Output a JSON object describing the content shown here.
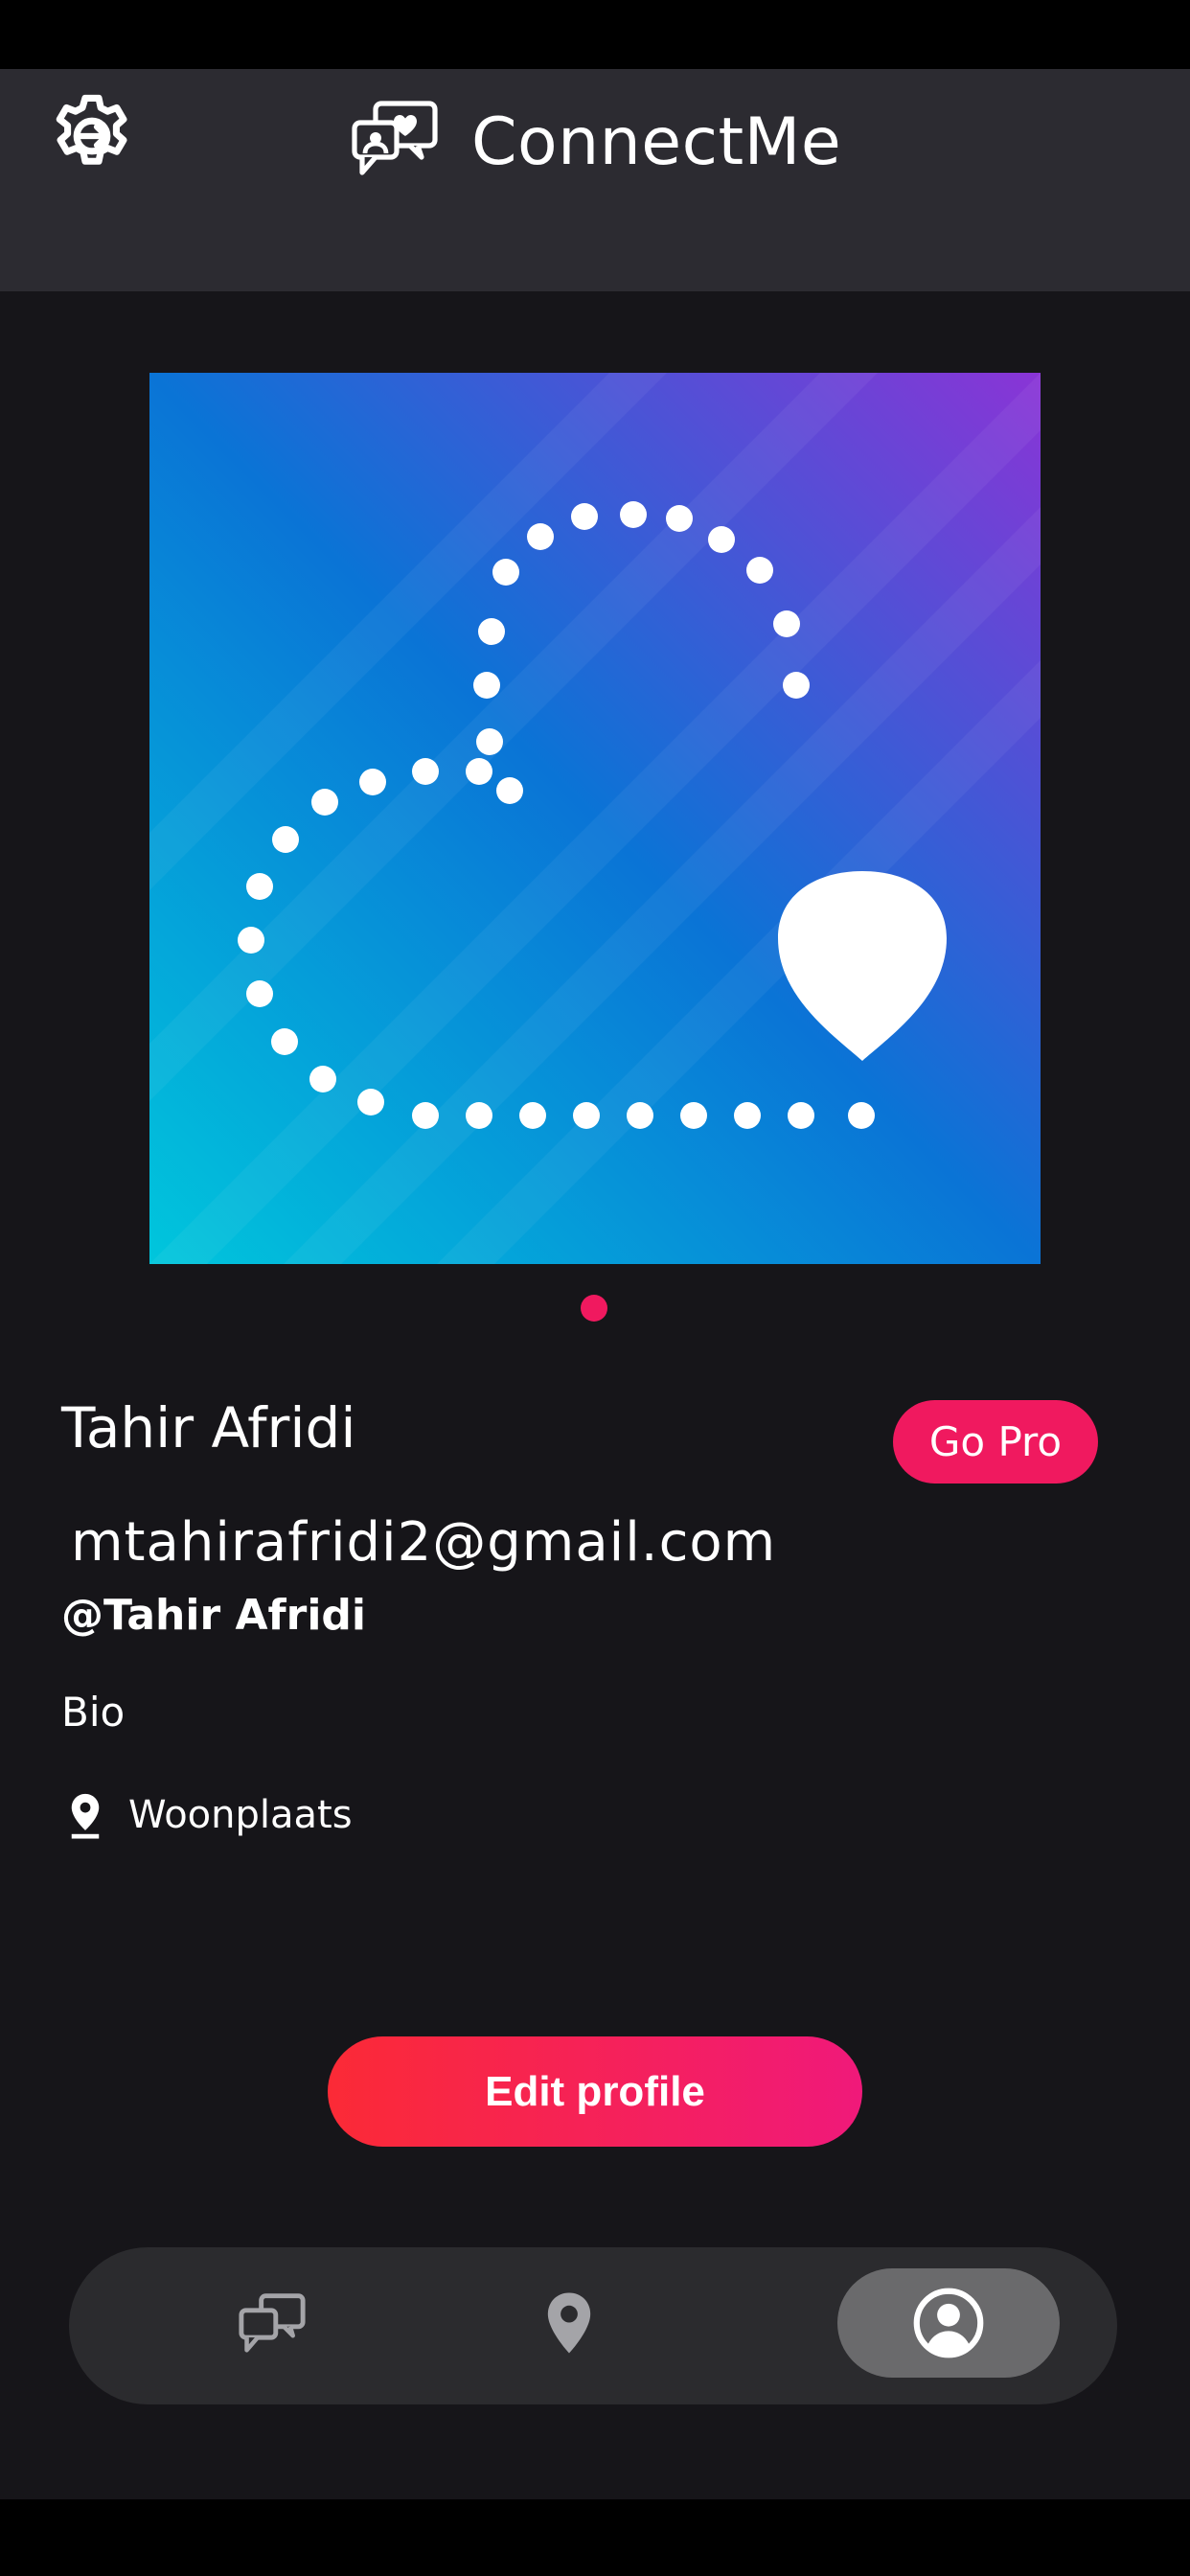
{
  "header": {
    "app_name": "ConnectMe",
    "settings_icon": "gear-icon",
    "logo_icon": "chat-bubbles-heart-icon"
  },
  "profile": {
    "photo_icon": "dotted-heart-location-pin-illustration",
    "photo_gradient": [
      "#00c6dc",
      "#0a74d6",
      "#8a34d6"
    ],
    "page_indicator_color": "#f0195f",
    "name": "Tahir Afridi",
    "go_pro_label": "Go Pro",
    "email": "mtahirafridi2@gmail.com",
    "handle": "@Tahir Afridi",
    "bio": "Bio",
    "location_icon": "location-pin-icon",
    "location": "Woonplaats",
    "edit_button_label": "Edit profile"
  },
  "bottom_nav": {
    "items": [
      {
        "icon": "chats-icon",
        "active": false
      },
      {
        "icon": "map-pin-icon",
        "active": false
      },
      {
        "icon": "profile-icon",
        "active": true
      }
    ]
  },
  "colors": {
    "accent": "#f0195f",
    "header_bg": "#2c2b31",
    "content_bg": "#161519",
    "nav_bg": "#2b2b2e",
    "nav_active_bg": "#6a6a6c"
  }
}
